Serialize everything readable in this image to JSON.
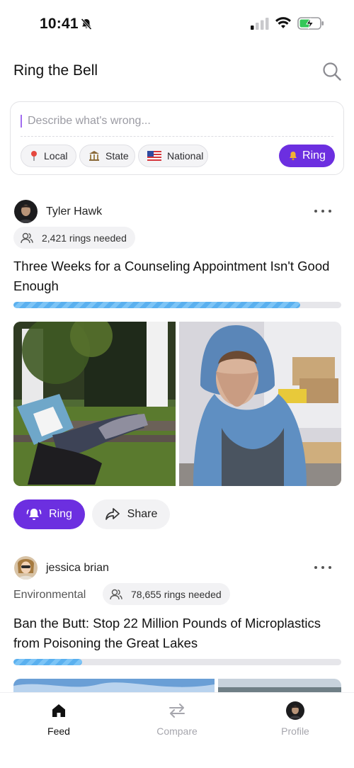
{
  "status_bar": {
    "time": "10:41"
  },
  "header": {
    "title": "Ring the Bell"
  },
  "composer": {
    "placeholder": "Describe what's wrong...",
    "scopes": [
      {
        "label": "Local",
        "icon": "pin-icon"
      },
      {
        "label": "State",
        "icon": "capitol-icon"
      },
      {
        "label": "National",
        "icon": "us-flag-icon"
      }
    ],
    "ring_label": "Ring"
  },
  "posts": [
    {
      "author": "Tyler Hawk",
      "rings_needed": "2,421 rings needed",
      "title": "Three Weeks for a Counseling Appointment Isn't Good Enough",
      "progress": 0.875,
      "actions": {
        "ring": "Ring",
        "share": "Share"
      }
    },
    {
      "author": "jessica brian",
      "category": "Environmental",
      "rings_needed": "78,655 rings needed",
      "title": "Ban the Butt: Stop 22 Million Pounds of Microplastics from Poisoning the Great Lakes",
      "progress": 0.21
    }
  ],
  "bottom_nav": [
    {
      "label": "Feed",
      "icon": "home-icon",
      "active": true
    },
    {
      "label": "Compare",
      "icon": "compare-arrows-icon",
      "active": false
    },
    {
      "label": "Profile",
      "icon": "avatar-icon",
      "active": false
    }
  ],
  "colors": {
    "accent": "#6c2fe0",
    "progress": "#5ab0ef"
  }
}
